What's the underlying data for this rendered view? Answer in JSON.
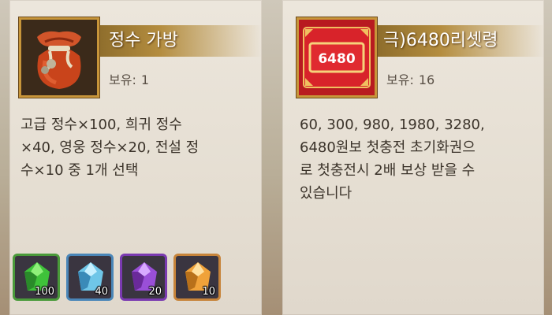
{
  "left_card": {
    "title": "정수 가방",
    "own_label": "보유:",
    "own_value": "1",
    "desc_lines": [
      "고급 정수×100, 희귀 정수",
      "×40, 영웅 정수×20, 전설 정",
      "수×10 중 1개 선택"
    ],
    "icon": "essence-pouch-icon",
    "gems": [
      {
        "name": "green-gem-icon",
        "qty": "100",
        "color": "#3fc23a",
        "border": "#4a9a3a"
      },
      {
        "name": "blue-gem-icon",
        "qty": "40",
        "color": "#6fc6e8",
        "border": "#4a86b8"
      },
      {
        "name": "purple-gem-icon",
        "qty": "20",
        "color": "#9a4fd8",
        "border": "#7a3ab0"
      },
      {
        "name": "orange-gem-icon",
        "qty": "10",
        "color": "#f0a23a",
        "border": "#c7843a"
      }
    ]
  },
  "right_card": {
    "title": "극)6480리셋령",
    "own_label": "보유:",
    "own_value": "16",
    "desc_lines": [
      "60, 300, 980, 1980, 3280,",
      "6480원보 첫충전 초기화권으",
      "로 첫충전시 2배 보상 받을 수",
      "있습니다"
    ],
    "icon": "reset-token-icon",
    "token_label": "6480"
  },
  "colors": {
    "title_gold": "#b48d3f",
    "frame_gold": "#c7953a",
    "token_red": "#d8232a"
  }
}
